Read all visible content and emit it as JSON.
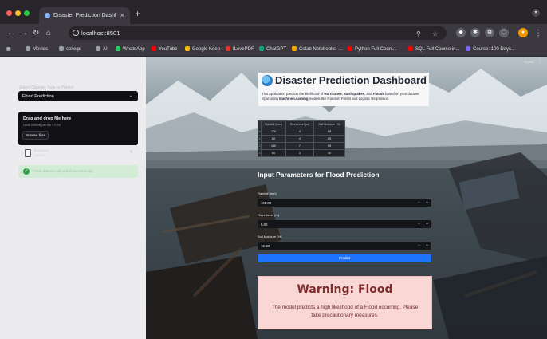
{
  "browser": {
    "tab_title": "Disaster Prediction Dashboar",
    "tab_close": "×",
    "new_tab": "+",
    "url": "localhost:8501",
    "bookmarks": [
      {
        "label": "Movies",
        "color": "#9aa0a6"
      },
      {
        "label": "college",
        "color": "#9aa0a6"
      },
      {
        "label": "AI",
        "color": "#9aa0a6"
      },
      {
        "label": "WhatsApp",
        "color": "#25d366"
      },
      {
        "label": "YouTube",
        "color": "#ff0000"
      },
      {
        "label": "Google Keep",
        "color": "#fbbc04"
      },
      {
        "label": "ILovePDF",
        "color": "#e5322d"
      },
      {
        "label": "ChatGPT",
        "color": "#10a37f"
      },
      {
        "label": "Colab Notebooks -...",
        "color": "#f9ab00"
      },
      {
        "label": "Python Full Cours...",
        "color": "#ff0000"
      },
      {
        "label": "SQL Full Course in...",
        "color": "#ff0000"
      },
      {
        "label": "Course: 100 Days...",
        "color": "#7b68ee"
      }
    ]
  },
  "sidebar": {
    "select_label": "Select Disaster Type to Predict",
    "select_value": "Flood Prediction",
    "uploader_title": "Drag and drop file here",
    "uploader_limit": "Limit 200MB per file • CSV",
    "browse_label": "Browse files",
    "file_name": "flood.csv",
    "file_size": "164.0B",
    "success_msg": "Flood dataset uploaded successfully!"
  },
  "main": {
    "deploy_label": "Deploy",
    "title": "Disaster Prediction Dashboard",
    "description_parts": {
      "p1": "This application predicts the likelihood of ",
      "b1": "Hurricanes",
      "p2": ", ",
      "b2": "Earthquakes",
      "p3": ", and ",
      "b3": "Floods",
      "p4": " based on your dataset input using ",
      "b4": "Machine Learning",
      "p5": " models like Random Forest and Logistic Regression."
    },
    "table": {
      "headers": [
        "",
        "Rainfall (mm)",
        "River Level (m)",
        "Soil Moisture (%)"
      ],
      "rows": [
        [
          "0",
          "120",
          "4",
          "85"
        ],
        [
          "1",
          "80",
          "4",
          "65"
        ],
        [
          "2",
          "140",
          "7",
          "95"
        ],
        [
          "3",
          "60",
          "3",
          "40"
        ]
      ]
    },
    "input_header": "Input Parameters for Flood Prediction",
    "fields": [
      {
        "label": "Rainfall (mm)",
        "value": "100.00"
      },
      {
        "label": "River Level (m)",
        "value": "5.00"
      },
      {
        "label": "Soil Moisture (%)",
        "value": "72.50"
      }
    ],
    "predict_label": "Predict",
    "warning_title": "Warning: Flood",
    "warning_msg": "The model predicts a high likelihood of a Flood occurring. Please take precautionary measures."
  }
}
